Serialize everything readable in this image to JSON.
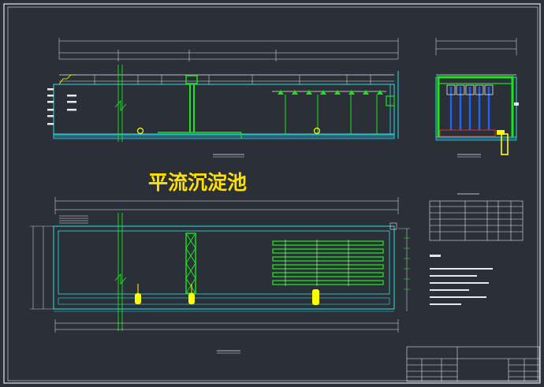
{
  "drawing": {
    "main_title": "平流沉淀池"
  },
  "colors": {
    "background": "#2a2f38",
    "frame": "#e8e8e8",
    "line_white": "#ffffff",
    "line_cyan": "#2ee0e0",
    "line_green": "#19e619",
    "line_yellow": "#ffff00",
    "line_blue": "#2060ff",
    "line_red": "#ff3030",
    "title_yellow": "#ffe100"
  },
  "icons": {
    "tank_section": "section-view-icon",
    "tank_plan": "plan-view-icon",
    "valve": "valve-icon"
  }
}
